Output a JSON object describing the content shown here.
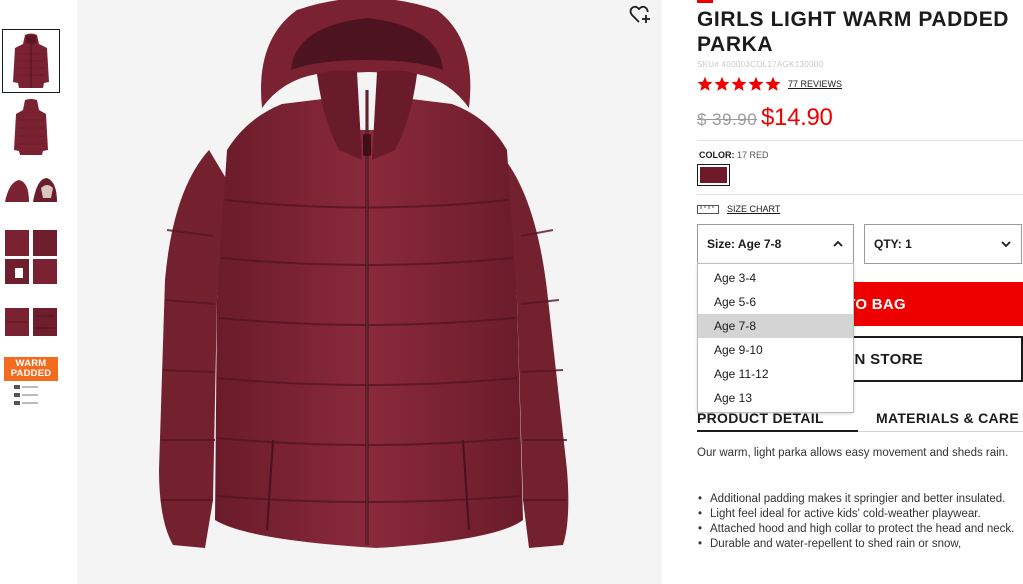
{
  "product": {
    "title": "GIRLS LIGHT WARM PADDED PARKA",
    "sku": "SKU# 400003COL17AGK130000",
    "rating_stars": 5,
    "reviews_label": "77 REVIEWS",
    "price_original": "$ 39.90",
    "price_sale": "$14.90",
    "color_label": "COLOR:",
    "color_value": "17 RED",
    "swatch_color": "#6e1a2a",
    "size_chart_label": "SIZE CHART"
  },
  "selectors": {
    "size_label": "Size: Age 7-8",
    "qty_label": "QTY: 1",
    "size_options": [
      "Age 3-4",
      "Age 5-6",
      "Age 7-8",
      "Age 9-10",
      "Age 11-12",
      "Age 13"
    ],
    "size_selected": "Age 7-8"
  },
  "buttons": {
    "add_to_bag": "TO BAG",
    "find_in_store": "IN STORE"
  },
  "tabs": {
    "detail": "PRODUCT DETAIL",
    "materials": "MATERIALS & CARE"
  },
  "detail": {
    "description": "Our warm, light parka allows easy movement and sheds rain.",
    "bullets": [
      "Additional padding makes it springier and better insulated.",
      "Light feel ideal for active kids' cold-weather playwear.",
      "Attached hood and high collar to protect the head and neck.",
      "Durable and water-repellent to shed rain or snow,"
    ]
  },
  "thumbnail_badge": {
    "line1": "WARM",
    "line2": "PADDED"
  },
  "colors": {
    "accent": "#ee0000",
    "jacket": "#7a2232"
  }
}
